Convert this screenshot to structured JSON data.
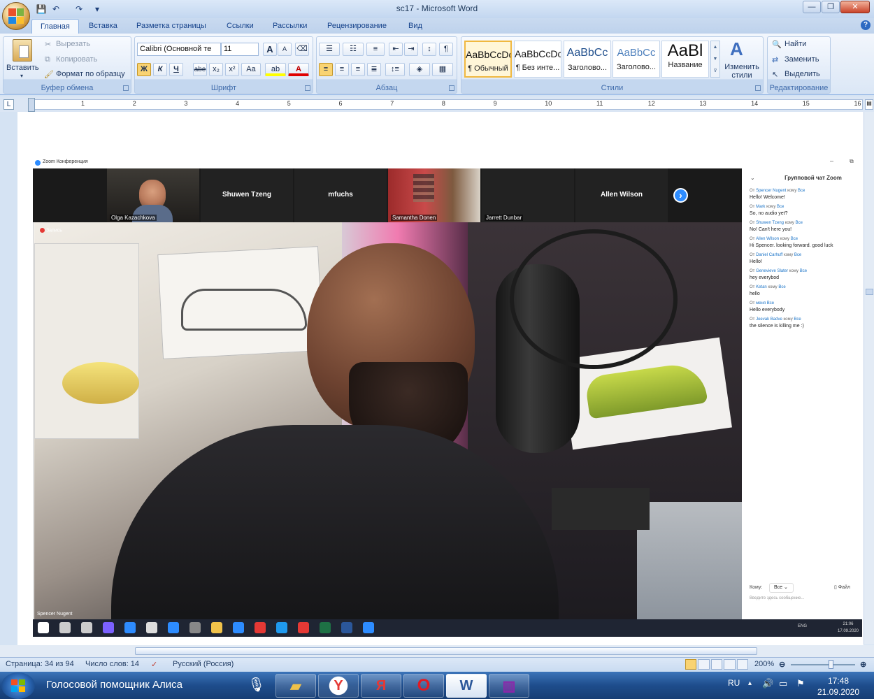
{
  "window": {
    "title": "sc17 - Microsoft Word",
    "min": "—",
    "max": "❐",
    "close": "✕"
  },
  "qat": {
    "save": "💾",
    "undo": "↶",
    "redo": "↷",
    "more": "▾"
  },
  "tabs": [
    "Главная",
    "Вставка",
    "Разметка страницы",
    "Ссылки",
    "Рассылки",
    "Рецензирование",
    "Вид"
  ],
  "help": "?",
  "clipboard": {
    "paste": "Вставить",
    "cut": "Вырезать",
    "copy": "Копировать",
    "format_painter": "Формат по образцу",
    "label": "Буфер обмена"
  },
  "font": {
    "name": "Calibri (Основной те",
    "size": "11",
    "grow": "A",
    "shrink": "A",
    "bold": "Ж",
    "italic": "К",
    "underline": "Ч",
    "strike": "abe",
    "sub": "x₂",
    "sup": "x²",
    "case": "Aa",
    "label": "Шрифт"
  },
  "paragraph": {
    "show_marks": "¶",
    "label": "Абзац"
  },
  "styles": {
    "items": [
      {
        "sample": "AaBbCcDc",
        "name": "¶ Обычный"
      },
      {
        "sample": "AaBbCcDc",
        "name": "¶ Без инте..."
      },
      {
        "sample": "AaBbCc",
        "name": "Заголово..."
      },
      {
        "sample": "AaBbCc",
        "name": "Заголово..."
      },
      {
        "sample": "AaBl",
        "name": "Название"
      }
    ],
    "change": "Изменить стили",
    "label": "Стили"
  },
  "editing": {
    "find": "Найти",
    "replace": "Заменить",
    "select": "Выделить",
    "label": "Редактирование"
  },
  "ruler": {
    "corner": "L",
    "numbers": [
      "1",
      "2",
      "3",
      "4",
      "5",
      "6",
      "7",
      "8",
      "9",
      "10",
      "11",
      "12",
      "13",
      "14",
      "15",
      "16"
    ]
  },
  "zoom_window": {
    "title": "Zoom Конференция",
    "recording": "Запись",
    "participants": [
      {
        "caption": "Olga Kazachkova",
        "name": ""
      },
      {
        "caption": "",
        "name": "Shuwen Tzeng"
      },
      {
        "caption": "",
        "name": "mfuchs"
      },
      {
        "caption": "Samantha Donen",
        "name": ""
      },
      {
        "caption": "Jarrett Dunbar",
        "name": ""
      },
      {
        "caption": "",
        "name": "Allen Wilson"
      }
    ],
    "next": "›",
    "speaker": "Spencer Nugent",
    "chat": {
      "title": "Групповой чат Zoom",
      "messages": [
        {
          "from_prefix": "От",
          "from": "Spencer Nugent",
          "to_prefix": "кому",
          "to": "Все",
          "text": "Hello! Welcome!"
        },
        {
          "from_prefix": "От",
          "from": "Mark",
          "to_prefix": "кому",
          "to": "Все",
          "text": "So, no audio yet?"
        },
        {
          "from_prefix": "От",
          "from": "Shuwen Tzeng",
          "to_prefix": "кому",
          "to": "Все",
          "text": "No! Can't here you!"
        },
        {
          "from_prefix": "От",
          "from": "Allen Wilson",
          "to_prefix": "кому",
          "to": "Все",
          "text": "Hi Spencer. looking forward. good luck"
        },
        {
          "from_prefix": "От",
          "from": "Daniel Carhuff",
          "to_prefix": "кому",
          "to": "Все",
          "text": "Hello!"
        },
        {
          "from_prefix": "От",
          "from": "Genevieve Slater",
          "to_prefix": "кому",
          "to": "Все",
          "text": "hey everybod"
        },
        {
          "from_prefix": "От",
          "from": "Ketan",
          "to_prefix": "кому",
          "to": "Все",
          "text": "hello"
        },
        {
          "from_prefix": "От",
          "from": "меня",
          "to_prefix": "",
          "to": "Все",
          "text": "Hello everybody"
        },
        {
          "from_prefix": "От",
          "from": "Jeevak Badve",
          "to_prefix": "кому",
          "to": "Все",
          "text": "the silence is killing me :)"
        }
      ],
      "to_label": "Кому:",
      "to_value": "Все",
      "file": "Файл",
      "placeholder": "Введите здесь сообщение..."
    },
    "tray": {
      "lang": "ENG",
      "time": "21:06",
      "date": "17.09.2020"
    }
  },
  "statusbar": {
    "page": "Страница: 34 из 94",
    "words": "Число слов: 14",
    "lang": "Русский (Россия)",
    "zoom": "200%"
  },
  "taskbar": {
    "alice": "Голосовой помощник Алиса",
    "lang": "RU",
    "time": "17:48",
    "date": "21.09.2020"
  }
}
